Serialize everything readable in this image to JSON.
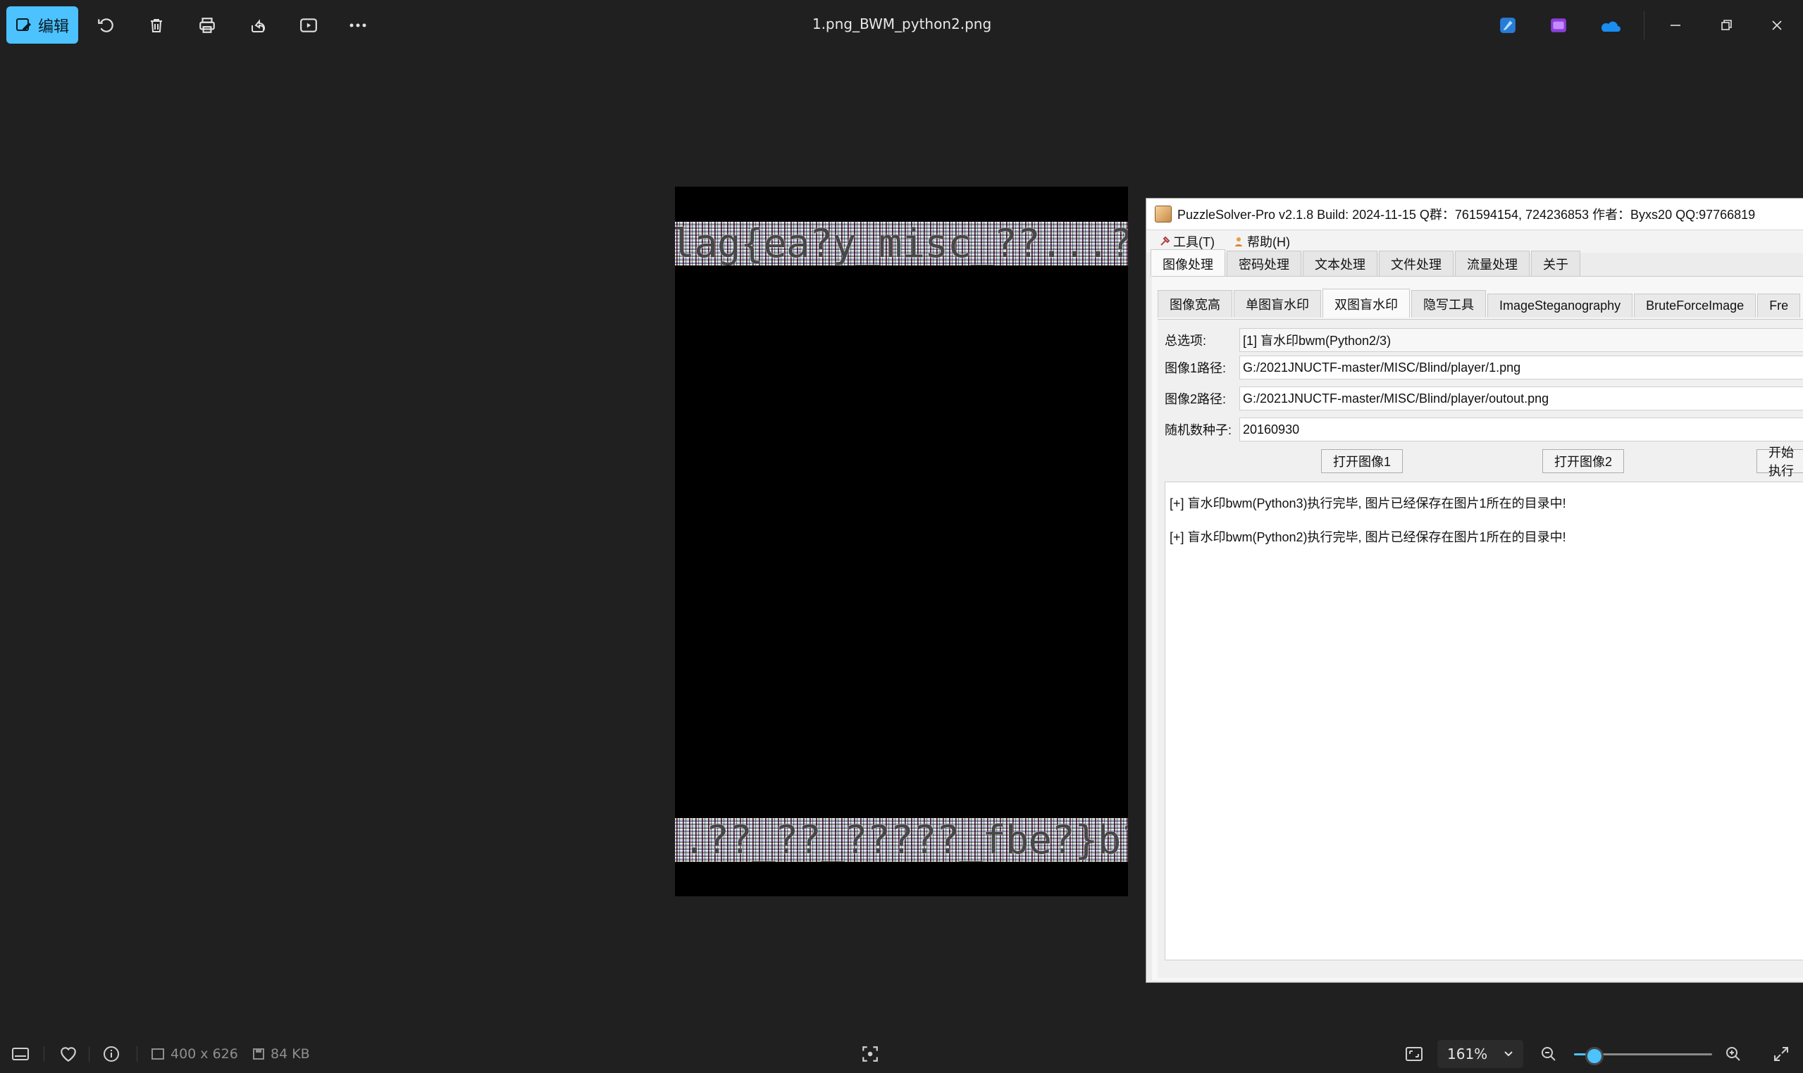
{
  "toolbar": {
    "edit_label": "编辑",
    "filename": "1.png_BWM_python2.png"
  },
  "image": {
    "top_band_text": "flag{ea?y_misc_??...??",
    "bottom_band_text": "...??_??_?????_fbe?}b?_"
  },
  "puzzlesolver": {
    "title": "PuzzleSolver-Pro v2.1.8  Build: 2024-11-15  Q群：761594154, 724236853  作者：Byxs20  QQ:97766819",
    "menu": [
      "工具(T)",
      "帮助(H)"
    ],
    "tabs": [
      "图像处理",
      "密码处理",
      "文本处理",
      "文件处理",
      "流量处理",
      "关于"
    ],
    "active_tab": 0,
    "subtabs": [
      "图像宽高",
      "单图盲水印",
      "双图盲水印",
      "隐写工具",
      "ImageSteganography",
      "BruteForceImage",
      "Fre"
    ],
    "active_subtab": 2,
    "fields": {
      "option_label": "总选项:",
      "option_value": "[1] 盲水印bwm(Python2/3)",
      "image1_label": "图像1路径:",
      "image1_value": "G:/2021JNUCTF-master/MISC/Blind/player/1.png",
      "image2_label": "图像2路径:",
      "image2_value": "G:/2021JNUCTF-master/MISC/Blind/player/outout.png",
      "seed_label": "随机数种子:",
      "seed_value": "20160930"
    },
    "buttons": {
      "open1": "打开图像1",
      "open2": "打开图像2",
      "start": "开始执行"
    },
    "log": [
      "[+] 盲水印bwm(Python3)执行完毕, 图片已经保存在图片1所在的目录中!",
      "[+] 盲水印bwm(Python2)执行完毕, 图片已经保存在图片1所在的目录中!"
    ]
  },
  "statusbar": {
    "dimensions": "400 x 626",
    "filesize": "84 KB",
    "zoom": "161%",
    "zoom_slider_fraction": 0.15
  },
  "colors": {
    "accent": "#4cc2ff",
    "background": "#202020"
  }
}
